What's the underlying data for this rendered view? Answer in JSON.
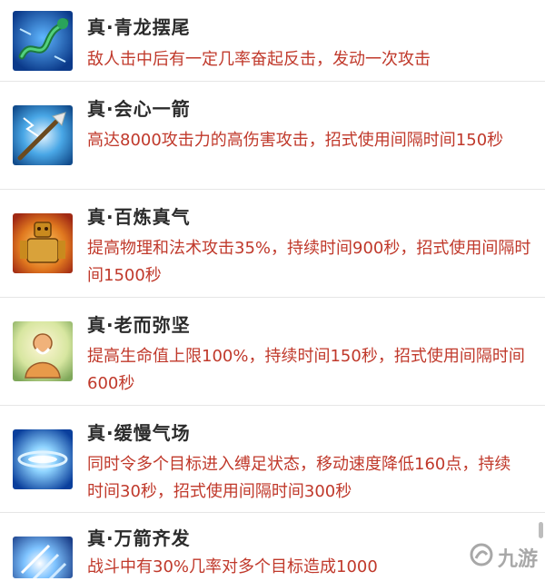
{
  "skills": [
    {
      "title": "真·青龙摆尾",
      "desc": "敌人击中后有一定几率奋起反击，发动一次攻击",
      "icon": "dragon-icon"
    },
    {
      "title": "真·会心一箭",
      "desc": "高达8000攻击力的高伤害攻击，招式使用间隔时间150秒",
      "icon": "arrow-icon"
    },
    {
      "title": "真·百炼真气",
      "desc": "提高物理和法术攻击35%，持续时间900秒，招式使用间隔时间1500秒",
      "icon": "golden-warrior-icon"
    },
    {
      "title": "真·老而弥坚",
      "desc": "提高生命值上限100%，持续时间150秒，招式使用间隔时间600秒",
      "icon": "elder-icon"
    },
    {
      "title": "真·缓慢气场",
      "desc": "同时令多个目标进入缚足状态，移动速度降低160点，持续时间30秒，招式使用间隔时间300秒",
      "icon": "vortex-icon"
    },
    {
      "title": "真·万箭齐发",
      "desc": "战斗中有30%几率对多个目标造成1000",
      "icon": "arrow-rain-icon"
    }
  ],
  "watermark": {
    "text": "九游",
    "icon": "jiuyou-logo-icon"
  },
  "colors": {
    "title": "#2b2b2b",
    "desc": "#c0392b",
    "divider": "#e6e6e6"
  }
}
